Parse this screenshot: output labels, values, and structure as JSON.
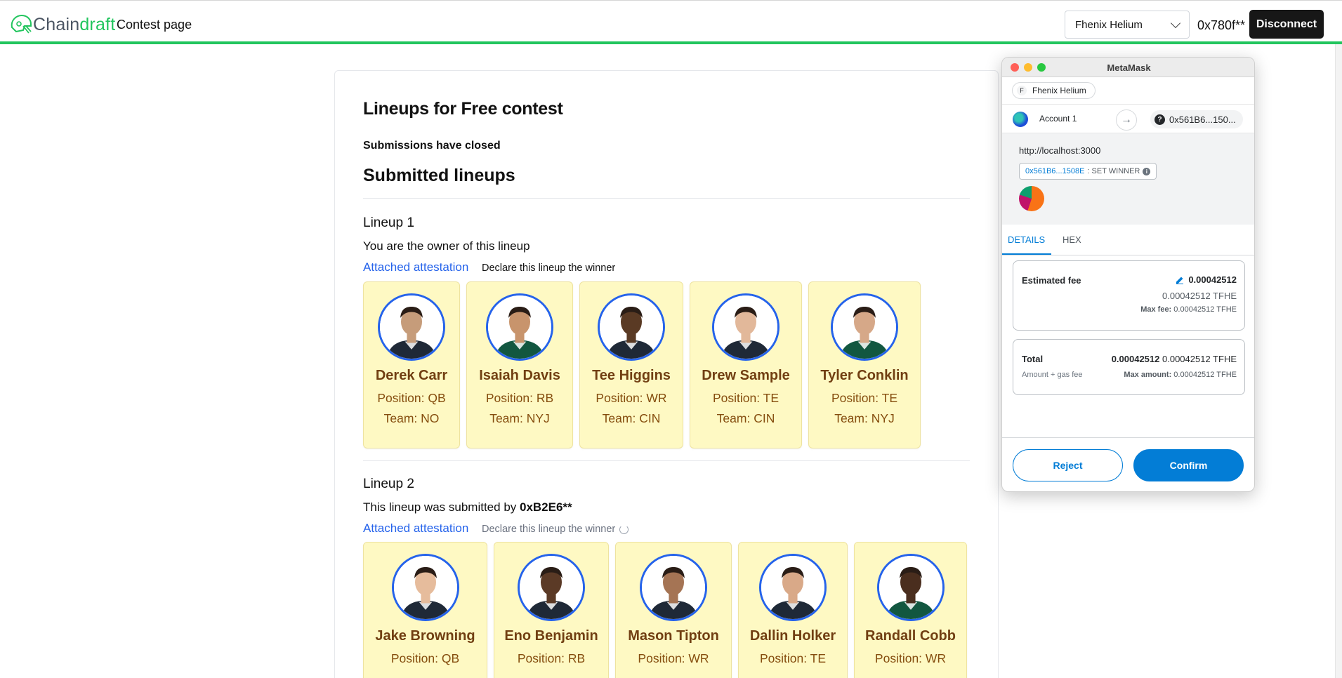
{
  "nav": {
    "brand_main": "Chain",
    "brand_accent": "draft",
    "link": "Contest page",
    "network_select": "Fhenix Helium",
    "address": "0x780f**",
    "disconnect_label": "Disconnect"
  },
  "contest": {
    "title": "Lineups for Free contest",
    "status": "Submissions have closed",
    "section_title": "Submitted lineups",
    "lineups": [
      {
        "title": "Lineup 1",
        "owner_text": "You are the owner of this lineup",
        "owner_addr": "",
        "attestation_label": "Attached attestation",
        "declare_label": "Declare this lineup the winner",
        "players": [
          {
            "name": "Derek Carr",
            "position": "Position: QB",
            "team": "Team: NO",
            "jersey": "#1f2937",
            "skin": "#c69c7a"
          },
          {
            "name": "Isaiah Davis",
            "position": "Position: RB",
            "team": "Team: NYJ",
            "jersey": "#125740",
            "skin": "#c8946c"
          },
          {
            "name": "Tee Higgins",
            "position": "Position: WR",
            "team": "Team: CIN",
            "jersey": "#1f2937",
            "skin": "#5a3a24"
          },
          {
            "name": "Drew Sample",
            "position": "Position: TE",
            "team": "Team: CIN",
            "jersey": "#1f2937",
            "skin": "#e2b89a"
          },
          {
            "name": "Tyler Conklin",
            "position": "Position: TE",
            "team": "Team: NYJ",
            "jersey": "#125740",
            "skin": "#d6a888"
          }
        ]
      },
      {
        "title": "Lineup 2",
        "owner_text": "This lineup was submitted by ",
        "owner_addr": "0xB2E6**",
        "attestation_label": "Attached attestation",
        "declare_label": "Declare this lineup the winner",
        "players": [
          {
            "name": "Jake Browning",
            "position": "Position: QB",
            "team": "",
            "jersey": "#1f2937",
            "skin": "#e6bc9c"
          },
          {
            "name": "Eno Benjamin",
            "position": "Position: RB",
            "team": "",
            "jersey": "#1f2937",
            "skin": "#5b3a26"
          },
          {
            "name": "Mason Tipton",
            "position": "Position: WR",
            "team": "",
            "jersey": "#1f2937",
            "skin": "#a57454"
          },
          {
            "name": "Dallin Holker",
            "position": "Position: TE",
            "team": "",
            "jersey": "#1f2937",
            "skin": "#d9a988"
          },
          {
            "name": "Randall Cobb",
            "position": "Position: WR",
            "team": "",
            "jersey": "#125740",
            "skin": "#4a2e1e"
          }
        ]
      }
    ]
  },
  "metamask": {
    "window_title": "MetaMask",
    "network": "Fhenix Helium",
    "network_initial": "F",
    "account": "Account 1",
    "to_address": "0x561B6...150...",
    "origin": "http://localhost:3000",
    "method_address": "0x561B6...1508E",
    "method_name": ": SET WINNER",
    "tabs": [
      "DETAILS",
      "HEX"
    ],
    "fee": {
      "label": "Estimated fee",
      "value_bold": "0.00042512",
      "value_sub": "0.00042512 TFHE",
      "max_label": "Max fee:",
      "max_value": "0.00042512 TFHE"
    },
    "total": {
      "label": "Total",
      "sub_label": "Amount + gas fee",
      "value_bold": "0.00042512",
      "value_rest": "0.00042512 TFHE",
      "max_label": "Max amount:",
      "max_value": "0.00042512 TFHE"
    },
    "reject_label": "Reject",
    "confirm_label": "Confirm"
  }
}
